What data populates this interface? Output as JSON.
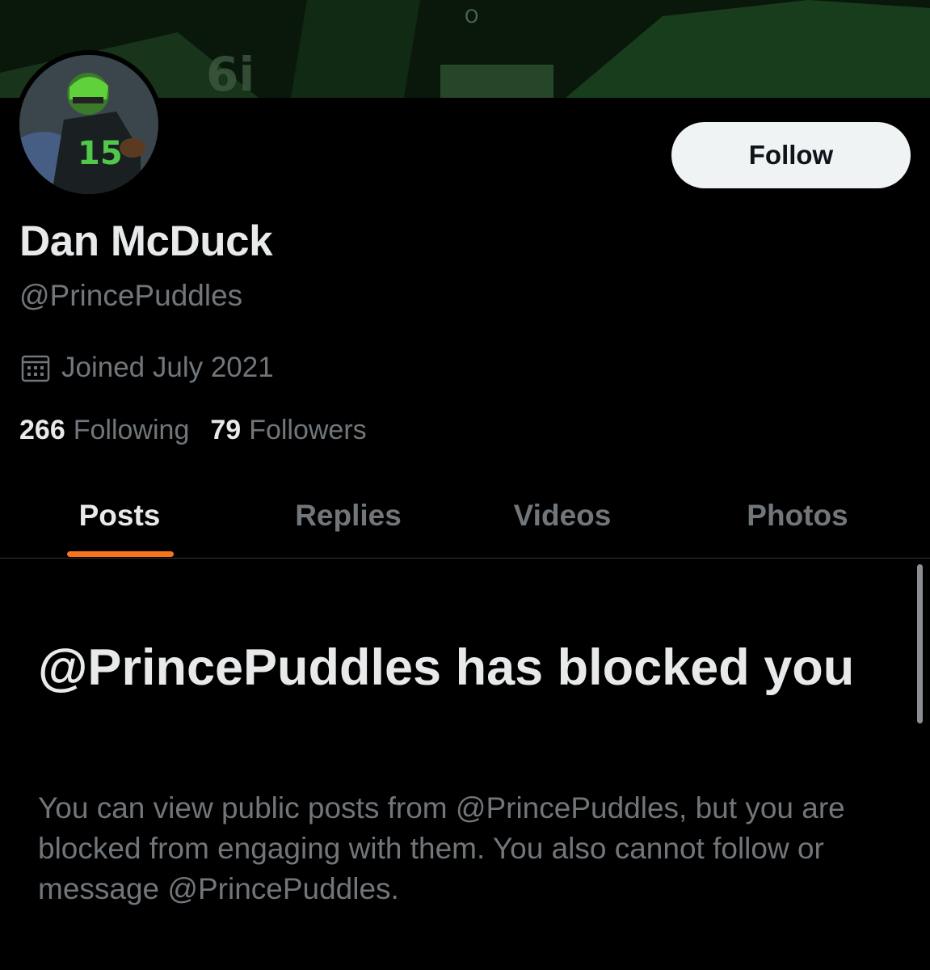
{
  "profile": {
    "follow_label": "Follow",
    "display_name": "Dan McDuck",
    "handle": "@PrincePuddles",
    "joined": "Joined July 2021",
    "following_count": "266",
    "following_label": "Following",
    "followers_count": "79",
    "followers_label": "Followers"
  },
  "tabs": [
    {
      "label": "Posts",
      "active": true
    },
    {
      "label": "Replies",
      "active": false
    },
    {
      "label": "Videos",
      "active": false
    },
    {
      "label": "Photos",
      "active": false
    }
  ],
  "blocked": {
    "title": "@PrincePuddles has blocked you",
    "message": "You can view public posts from @PrincePuddles, but you are blocked from engaging with them. You also cannot follow or message @PrincePuddles."
  },
  "colors": {
    "background": "#000000",
    "accent": "#f9731a",
    "text_primary": "#e7e9ea",
    "text_secondary": "#71767b",
    "button_bg": "#eff3f4"
  },
  "icons": {
    "calendar": "calendar-icon"
  }
}
